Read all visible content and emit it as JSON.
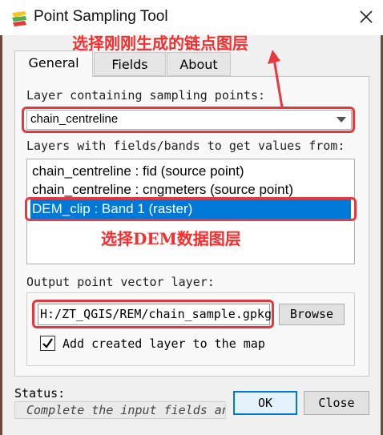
{
  "window": {
    "title": "Point Sampling Tool",
    "close_icon": "close-icon",
    "app_icon": "qgis-icon"
  },
  "tabs": [
    {
      "label": "General",
      "active": true
    },
    {
      "label": "Fields",
      "active": false
    },
    {
      "label": "About",
      "active": false
    }
  ],
  "general": {
    "sampling_label": "Layer containing sampling points:",
    "sampling_value": "chain_centreline",
    "layers_label": "Layers with fields/bands to get values from:",
    "layers": [
      {
        "text": "chain_centreline : fid (source point)",
        "selected": false
      },
      {
        "text": "chain_centreline : cngmeters (source point)",
        "selected": false
      },
      {
        "text": "DEM_clip : Band 1 (raster)",
        "selected": true
      }
    ],
    "output_label": "Output point vector layer:",
    "output_value": "H:/ZT_QGIS/REM/chain_sample.gpkg",
    "browse_label": "Browse",
    "add_layer_label": "Add created layer to the map",
    "add_layer_checked": true
  },
  "footer": {
    "status_label": "Status:",
    "status_text": "Complete the input fields and",
    "ok_label": "OK",
    "close_label": "Close"
  },
  "annotations": {
    "top_note": "选择刚刚生成的链点图层",
    "middle_note": "选择DEM数据图层",
    "color": "#e8383d"
  }
}
